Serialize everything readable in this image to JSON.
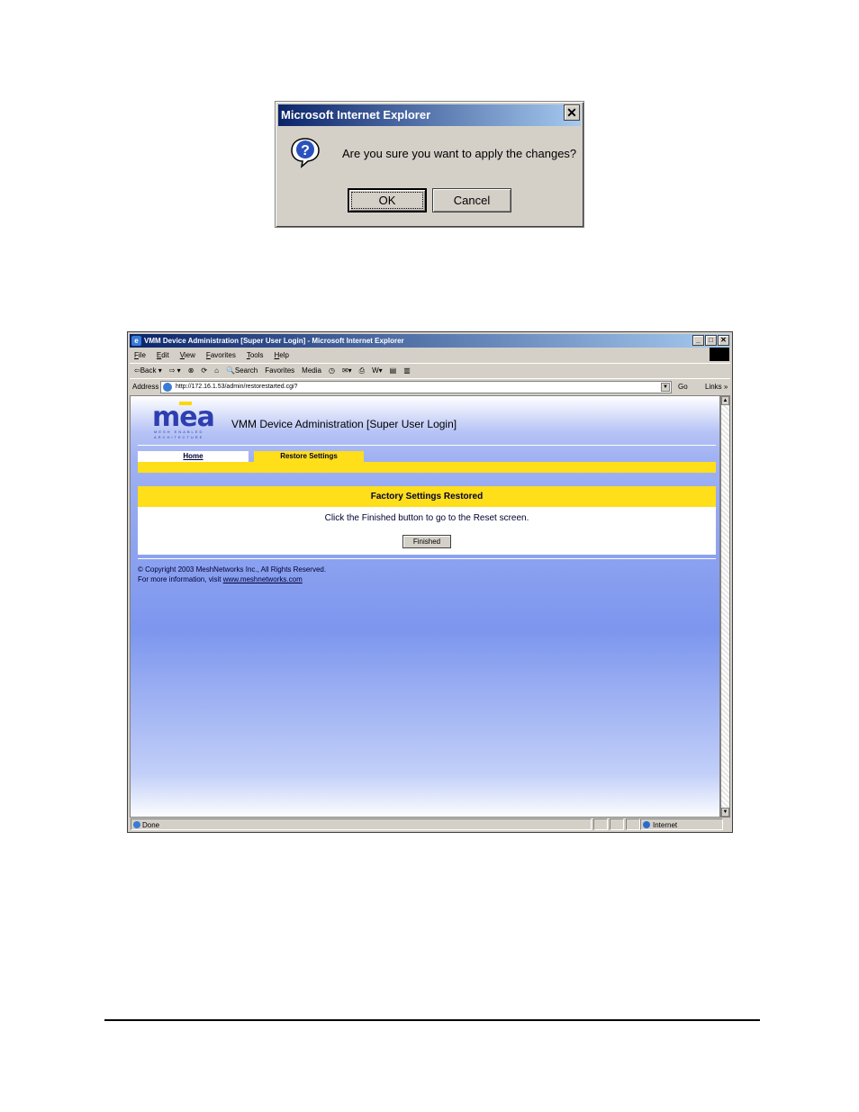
{
  "dialog": {
    "title": "Microsoft Internet Explorer",
    "close_glyph": "✕",
    "message": "Are you sure you want to apply the changes?",
    "ok_label": "OK",
    "cancel_label": "Cancel",
    "icon": "question-icon"
  },
  "browser": {
    "title": "VMM Device Administration [Super User Login] - Microsoft Internet Explorer",
    "window_buttons": [
      "_",
      "□",
      "✕"
    ],
    "menu": [
      "File",
      "Edit",
      "View",
      "Favorites",
      "Tools",
      "Help"
    ],
    "toolbar": [
      "⇦Back ▾",
      "⇨ ▾",
      "⊗",
      "⟳",
      "⌂",
      "🔍Search",
      "Favorites",
      "Media",
      "◷",
      "✉▾",
      "⎙",
      "W▾",
      "▤",
      "▥"
    ],
    "address_label": "Address",
    "address_value": "http://172.16.1.53/admin/restorestarted.cgi?",
    "go_label": "Go",
    "links_label": "Links »",
    "status_text": "Done",
    "zone_text": "Internet"
  },
  "page": {
    "logo_text": "mea",
    "logo_subtext": "MESH ENABLED ARCHITECTURE",
    "heading": "VMM Device Administration [Super User Login]",
    "tab_home": "Home",
    "tab_restore": "Restore Settings",
    "panel_title": "Factory Settings Restored",
    "panel_message": "Click the Finished button to go to the Reset screen.",
    "finished_label": "Finished",
    "copyright": "© Copyright 2003 MeshNetworks Inc., All Rights Reserved.",
    "more_info": "For more information, visit ",
    "more_info_link": "www.meshnetworks.com"
  },
  "colors": {
    "accent_yellow": "#ffde1a",
    "title_blue": "#0a246a",
    "page_blue": "#7d96ee"
  }
}
